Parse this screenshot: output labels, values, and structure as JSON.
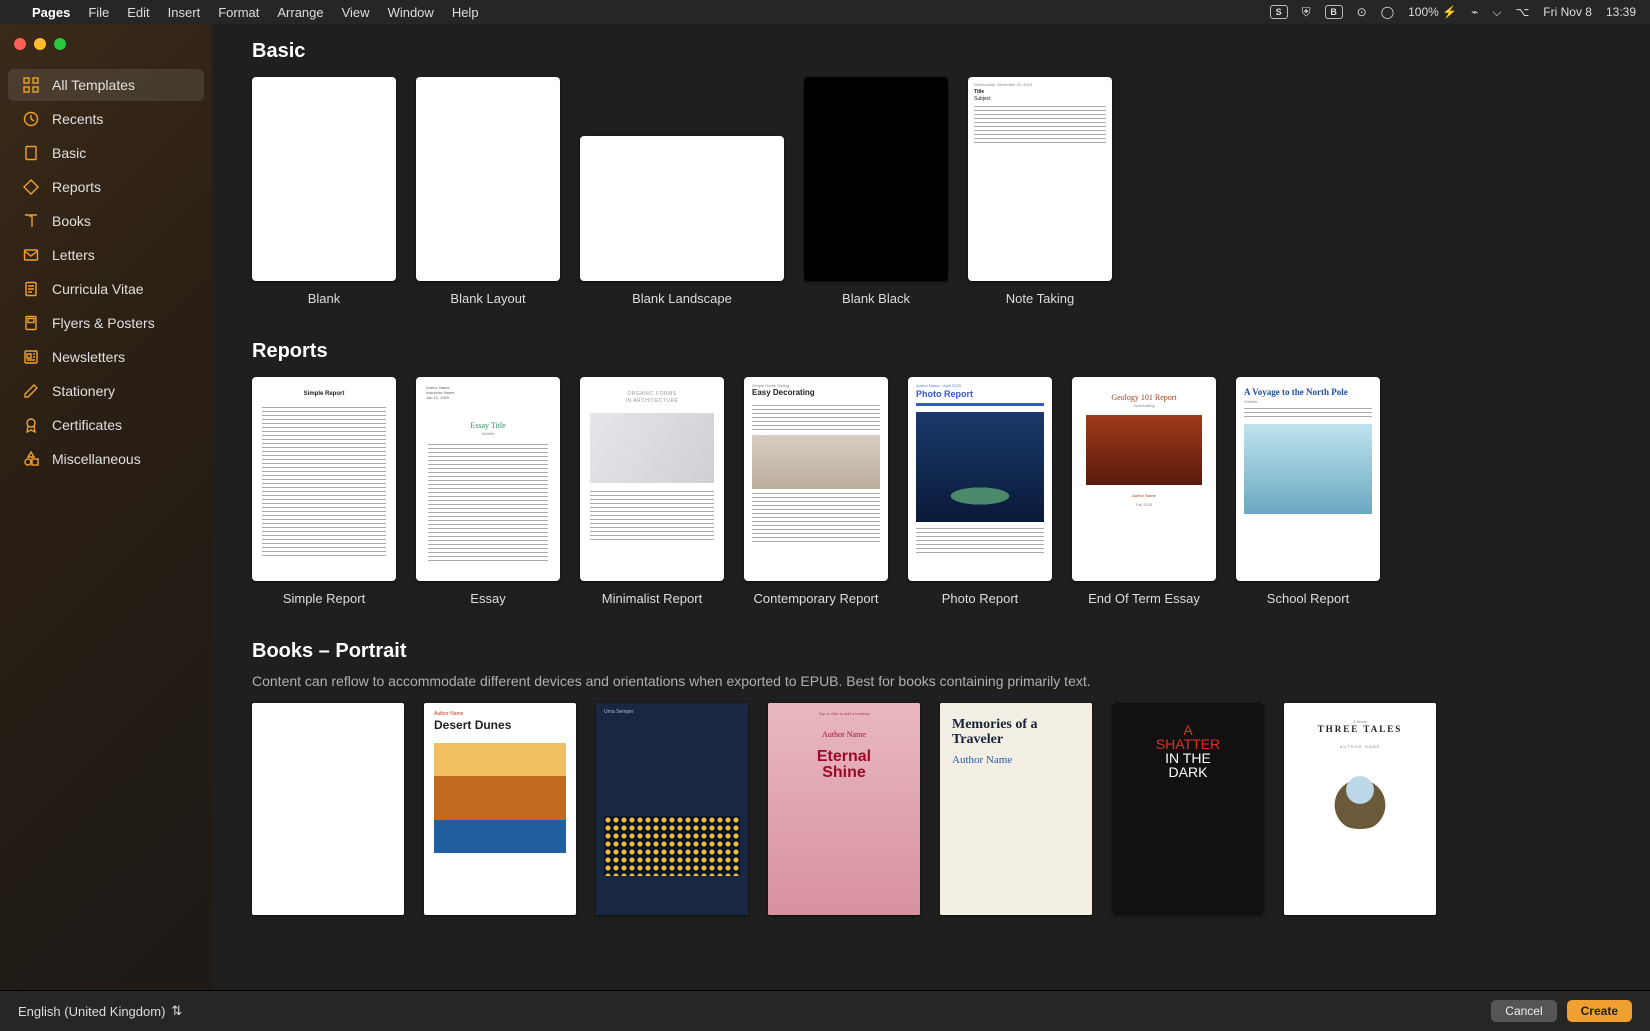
{
  "menubar": {
    "app": "Pages",
    "items": [
      "File",
      "Edit",
      "Insert",
      "Format",
      "Arrange",
      "View",
      "Window",
      "Help"
    ],
    "status": {
      "s_badge": "S",
      "b_badge": "B",
      "battery": "100%",
      "date": "Fri Nov 8",
      "time": "13:39"
    }
  },
  "sidebar": {
    "items": [
      {
        "id": "all",
        "label": "All Templates",
        "icon": "grid",
        "selected": true
      },
      {
        "id": "recents",
        "label": "Recents",
        "icon": "clock",
        "selected": false
      },
      {
        "id": "basic",
        "label": "Basic",
        "icon": "page",
        "selected": false
      },
      {
        "id": "reports",
        "label": "Reports",
        "icon": "diamond",
        "selected": false
      },
      {
        "id": "books",
        "label": "Books",
        "icon": "book",
        "selected": false
      },
      {
        "id": "letters",
        "label": "Letters",
        "icon": "envelope",
        "selected": false
      },
      {
        "id": "cv",
        "label": "Curricula Vitae",
        "icon": "doclines",
        "selected": false
      },
      {
        "id": "flyers",
        "label": "Flyers & Posters",
        "icon": "poster",
        "selected": false
      },
      {
        "id": "newsletters",
        "label": "Newsletters",
        "icon": "newspaper",
        "selected": false
      },
      {
        "id": "stationery",
        "label": "Stationery",
        "icon": "pencil",
        "selected": false
      },
      {
        "id": "certificates",
        "label": "Certificates",
        "icon": "ribbon",
        "selected": false
      },
      {
        "id": "misc",
        "label": "Miscellaneous",
        "icon": "shapes",
        "selected": false
      }
    ]
  },
  "sections": {
    "basic": {
      "title": "Basic",
      "templates": [
        {
          "id": "blank",
          "label": "Blank"
        },
        {
          "id": "blanklayout",
          "label": "Blank Layout"
        },
        {
          "id": "blankland",
          "label": "Blank Landscape"
        },
        {
          "id": "blankblack",
          "label": "Blank Black"
        },
        {
          "id": "notetaking",
          "label": "Note Taking"
        }
      ]
    },
    "reports": {
      "title": "Reports",
      "templates": [
        {
          "id": "simple",
          "label": "Simple Report",
          "thumb": {
            "title": "Simple Report"
          }
        },
        {
          "id": "essay",
          "label": "Essay",
          "thumb": {
            "title": "Essay Title",
            "subtitle": "Subtitle"
          }
        },
        {
          "id": "min",
          "label": "Minimalist Report",
          "thumb": {
            "line1": "ORGANIC FORMS",
            "line2": "IN ARCHITECTURE"
          }
        },
        {
          "id": "contemp",
          "label": "Contemporary Report",
          "thumb": {
            "kicker": "Simple Home Styling",
            "title": "Easy Decorating"
          }
        },
        {
          "id": "photo",
          "label": "Photo Report",
          "thumb": {
            "author": "Author Name · April 2025",
            "title": "Photo Report"
          }
        },
        {
          "id": "eot",
          "label": "End Of Term Essay",
          "thumb": {
            "title": "Geology 101 Report",
            "sub": "Subheading",
            "author": "Author Name",
            "term": "Fall 2025"
          }
        },
        {
          "id": "school",
          "label": "School Report",
          "thumb": {
            "title": "A Voyage to the North Pole",
            "sub": "Subtitle"
          }
        }
      ]
    },
    "books": {
      "title": "Books – Portrait",
      "subtitle": "Content can reflow to accommodate different devices and orientations when exported to EPUB. Best for books containing primarily text.",
      "templates": [
        {
          "id": "b_blank",
          "label": ""
        },
        {
          "id": "b_dunes",
          "label": "",
          "thumb": {
            "author": "Author Name",
            "title": "Desert Dunes"
          }
        },
        {
          "id": "b_urna",
          "label": "",
          "thumb": {
            "author": "Urna Semper"
          }
        },
        {
          "id": "b_eternal",
          "label": "",
          "thumb": {
            "hint": "Tap or click to add a heading",
            "author": "Author Name",
            "title1": "Eternal",
            "title2": "Shine"
          }
        },
        {
          "id": "b_mem",
          "label": "",
          "thumb": {
            "title": "Memories of a Traveler",
            "author": "Author Name"
          }
        },
        {
          "id": "b_shatter",
          "label": "",
          "thumb": {
            "l1": "A",
            "l2": "SHATTER",
            "l3": "IN THE",
            "l4": "DARK"
          }
        },
        {
          "id": "b_three",
          "label": "",
          "thumb": {
            "kicker": "A Novel",
            "title": "THREE TALES",
            "author": "AUTHOR NAME"
          }
        }
      ]
    }
  },
  "footer": {
    "language": "English (United Kingdom)",
    "cancel": "Cancel",
    "create": "Create"
  }
}
